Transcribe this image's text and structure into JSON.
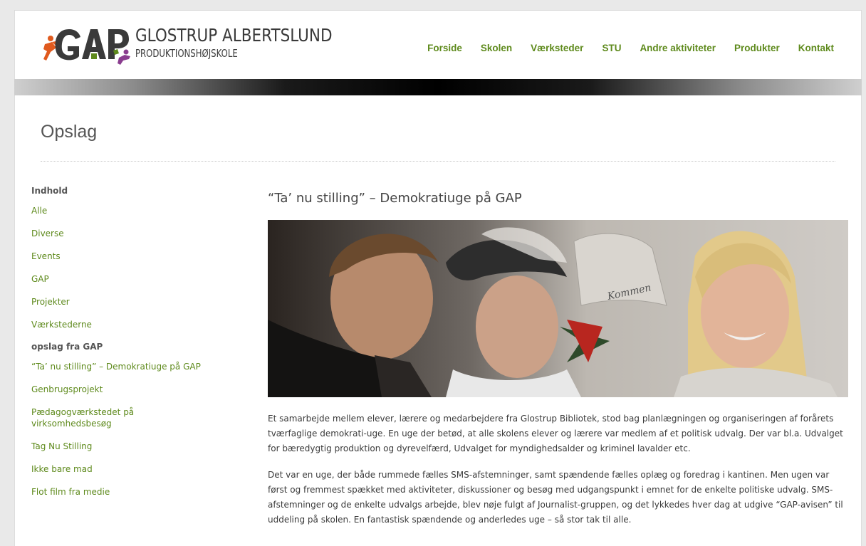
{
  "logo": {
    "line1": "GLOSTRUP ALBERTSLUND",
    "line2": "PRODUKTIONSHØJSKOLE",
    "colors": {
      "green": "#5e8a1c",
      "orange": "#e05a1e",
      "purple": "#8a3d8f",
      "dark": "#3a3a3a"
    }
  },
  "nav": [
    "Forside",
    "Skolen",
    "Værksteder",
    "STU",
    "Andre aktiviteter",
    "Produkter",
    "Kontakt"
  ],
  "page_title": "Opslag",
  "sidebar": {
    "heading1": "Indhold",
    "categories": [
      "Alle",
      "Diverse",
      "Events",
      "GAP",
      "Projekter",
      "Værkstederne"
    ],
    "heading2": "opslag fra GAP",
    "posts": [
      "“Ta’ nu stilling” – Demokratiuge på GAP",
      "Genbrugsprojekt",
      "Pædagogværkstedet på virksomhedsbesøg",
      "Tag Nu Stilling",
      "Ikke bare mad",
      "Flot film fra medie"
    ]
  },
  "article": {
    "title": "“Ta’ nu stilling” – Demokratiuge på GAP",
    "image_text": "Kommen",
    "paragraphs": [
      "Et samarbejde mellem elever, lærere og medarbejdere fra Glostrup Bibliotek, stod bag planlægningen og organiseringen af forårets tværfaglige demokrati-uge. En uge der betød, at alle skolens elever og lærere var medlem af et politisk udvalg. Der var bl.a. Udvalget for bæredygtig produktion og dyrevelfærd, Udvalget for myndighedsalder og kriminel lavalder etc.",
      "Det var en uge, der både rummede fælles SMS-afstemninger, samt spændende fælles oplæg og foredrag i kantinen. Men ugen var først og fremmest spækket med aktiviteter, diskussioner og besøg med udgangspunkt i emnet for de enkelte politiske udvalg. SMS-afstemninger og de enkelte udvalgs arbejde, blev nøje fulgt af Journalist-gruppen, og det lykkedes hver dag at udgive “GAP-avisen” til uddeling på skolen. En fantastisk spændende og anderledes uge – så stor tak til alle."
    ]
  }
}
